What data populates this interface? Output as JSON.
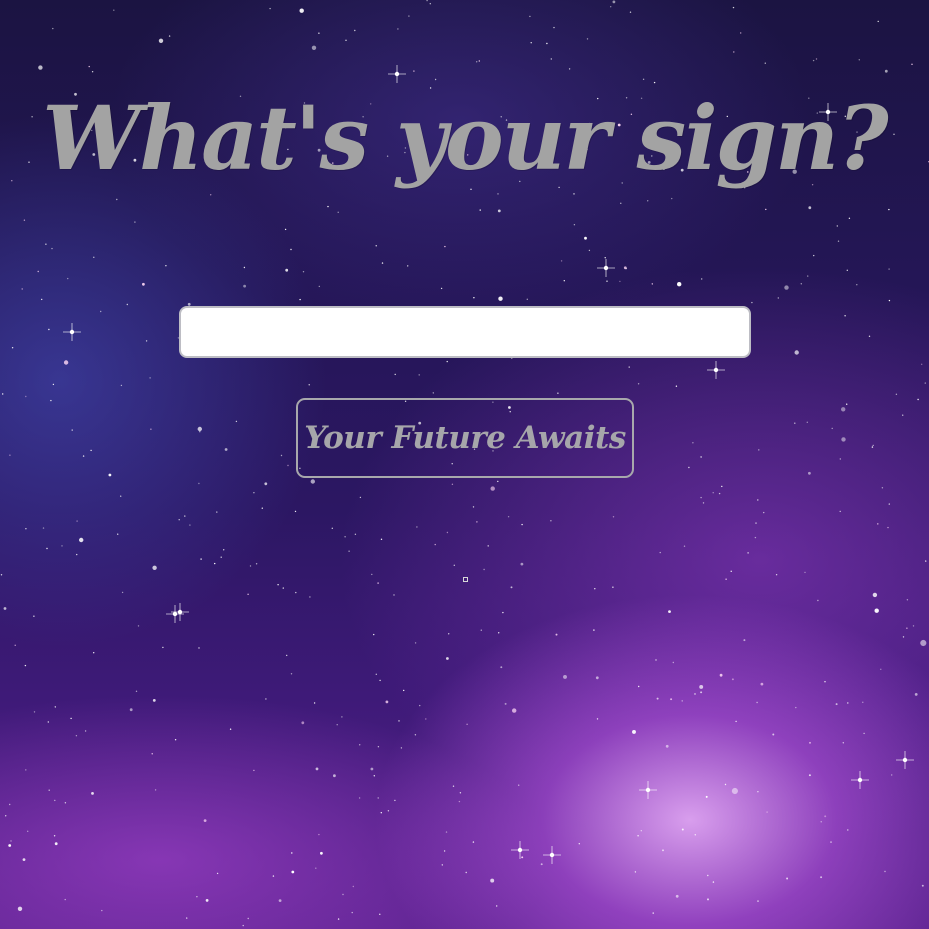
{
  "page": {
    "headline": "What's your sign?",
    "input": {
      "value": "",
      "placeholder": ""
    },
    "button_label": "Your Future Awaits"
  },
  "colors": {
    "text_gray": "#a3a3a3",
    "input_bg": "#ffffff",
    "space_dark": "#1b1442",
    "nebula_pink": "#e8b0ff"
  }
}
